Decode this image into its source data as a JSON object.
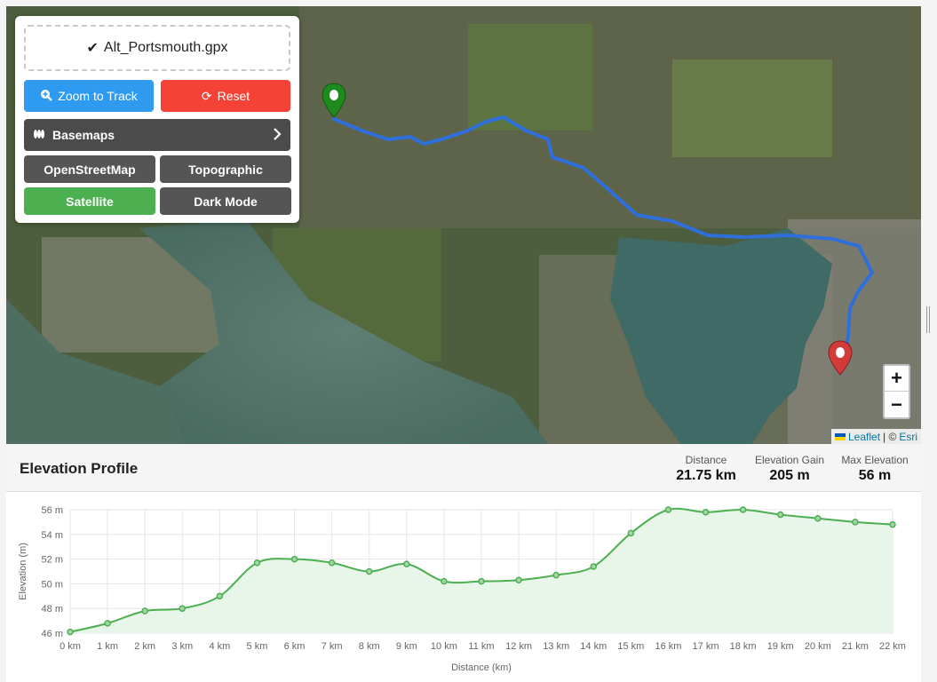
{
  "controls": {
    "file_name": "Alt_Portsmouth.gpx",
    "zoom_label": "Zoom to Track",
    "reset_label": "Reset",
    "basemaps_label": "Basemaps",
    "layers": [
      "OpenStreetMap",
      "Topographic",
      "Satellite",
      "Dark Mode"
    ],
    "active_layer": "Satellite"
  },
  "map": {
    "zoom_in": "+",
    "zoom_out": "−",
    "attribution_leaflet": "Leaflet",
    "attribution_sep": " | © ",
    "attribution_esri": "Esri",
    "start_marker_color": "#1e8a1e",
    "end_marker_color": "#d33b3b",
    "track_color": "#2f6fdc"
  },
  "elevation": {
    "title": "Elevation Profile",
    "stats": [
      {
        "label": "Distance",
        "value": "21.75 km"
      },
      {
        "label": "Elevation Gain",
        "value": "205 m"
      },
      {
        "label": "Max Elevation",
        "value": "56 m"
      }
    ]
  },
  "chart_data": {
    "type": "area",
    "xlabel": "Distance (km)",
    "ylabel": "Elevation (m)",
    "xlim": [
      0,
      22
    ],
    "ylim": [
      46,
      56
    ],
    "x_ticks": [
      "0 km",
      "1 km",
      "2 km",
      "3 km",
      "4 km",
      "5 km",
      "6 km",
      "7 km",
      "8 km",
      "9 km",
      "10 km",
      "11 km",
      "12 km",
      "13 km",
      "14 km",
      "15 km",
      "16 km",
      "17 km",
      "18 km",
      "19 km",
      "20 km",
      "21 km",
      "22 km"
    ],
    "y_ticks": [
      "46 m",
      "48 m",
      "50 m",
      "52 m",
      "54 m",
      "56 m"
    ],
    "y_tick_values": [
      46,
      48,
      50,
      52,
      54,
      56
    ],
    "x": [
      0,
      1,
      2,
      3,
      4,
      5,
      6,
      7,
      8,
      9,
      10,
      11,
      12,
      13,
      14,
      15,
      16,
      17,
      18,
      19,
      20,
      21,
      22
    ],
    "values": [
      46.1,
      46.8,
      47.8,
      48.0,
      49.0,
      51.7,
      52.0,
      51.7,
      51.0,
      51.6,
      50.2,
      50.2,
      50.3,
      50.7,
      51.4,
      54.1,
      56.0,
      55.8,
      56.0,
      55.6,
      55.3,
      55.0,
      54.8
    ],
    "line_color": "#4caf50",
    "fill_color": "#e8f5e9",
    "grid": true
  }
}
